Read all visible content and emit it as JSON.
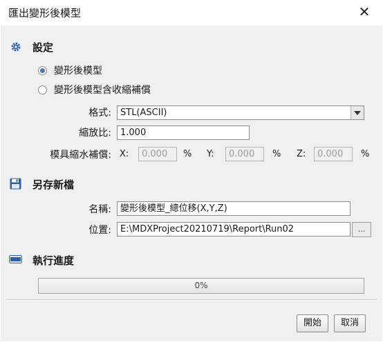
{
  "window": {
    "title": "匯出變形後模型"
  },
  "settings": {
    "section_title": "設定",
    "option_deformed": "變形後模型",
    "option_deformed_shrink": "變形後模型含收縮補償",
    "selected_option": "option_deformed",
    "format_label": "格式:",
    "format_value": "STL(ASCII)",
    "scale_label": "縮放比:",
    "scale_value": "1.000",
    "shrink_label": "模具縮水補償:",
    "x_label": "X:",
    "x_value": "0.000",
    "y_label": "Y:",
    "y_value": "0.000",
    "z_label": "Z:",
    "z_value": "0.000",
    "percent": "%"
  },
  "save": {
    "section_title": "另存新檔",
    "name_label": "名稱:",
    "name_value": "變形後模型_總位移(X,Y,Z)",
    "location_label": "位置:",
    "location_value": "E:\\MDXProject20210719\\Report\\Run02",
    "browse_label": "..."
  },
  "progress": {
    "section_title": "執行進度",
    "value": 0,
    "label": "0%"
  },
  "buttons": {
    "start": "開始",
    "cancel": "取消"
  },
  "colors": {
    "accent": "#4a78b0",
    "icon_blue": "#2f5f9e"
  },
  "icons": {
    "settings": "gear-icon",
    "save": "floppy-disk-icon",
    "progress": "progress-bar-icon",
    "close": "close-icon"
  }
}
